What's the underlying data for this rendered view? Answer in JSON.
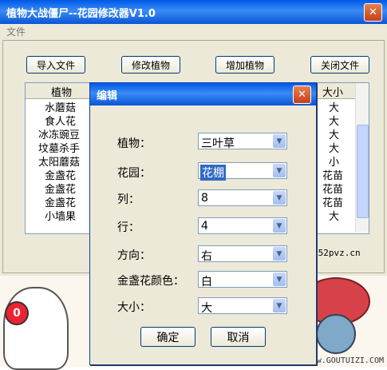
{
  "main_window": {
    "title": "植物大战僵尸--花园修改器V1.0",
    "menu": {
      "file": "文件"
    },
    "buttons": {
      "import": "导入文件",
      "modify": "修改植物",
      "add": "增加植物",
      "close": "关闭文件"
    },
    "table": {
      "columns": [
        "植物",
        "大小"
      ],
      "rows": [
        {
          "plant": "水蘑菇",
          "size": "大"
        },
        {
          "plant": "食人花",
          "size": "大"
        },
        {
          "plant": "冰冻豌豆",
          "size": "大"
        },
        {
          "plant": "坟墓杀手",
          "size": "大"
        },
        {
          "plant": "太阳蘑菇",
          "size": "小"
        },
        {
          "plant": "金盏花",
          "size": "花苗"
        },
        {
          "plant": "金盏花",
          "size": "花苗"
        },
        {
          "plant": "金盏花",
          "size": "花苗"
        },
        {
          "plant": "小墙果",
          "size": "大"
        }
      ]
    },
    "footer_url_partial": ".52pvz.cn"
  },
  "dialog": {
    "title": "编辑",
    "fields": {
      "plant": {
        "label": "植物：",
        "value": "三叶草"
      },
      "garden": {
        "label": "花园：",
        "value": "花棚"
      },
      "column": {
        "label": "列：",
        "value": "8"
      },
      "row": {
        "label": "行：",
        "value": "4"
      },
      "direction": {
        "label": "方向：",
        "value": "右"
      },
      "marigold_color": {
        "label": "金盏花颜色：",
        "value": "白"
      },
      "size": {
        "label": "大小：",
        "value": "大"
      }
    },
    "ok": "确定",
    "cancel": "取消"
  },
  "background": {
    "badge": "0",
    "watermark": "www.GOUTUIZI.COM"
  },
  "icons": {
    "close": "close-icon",
    "dropdown": "chevron-down-icon"
  }
}
